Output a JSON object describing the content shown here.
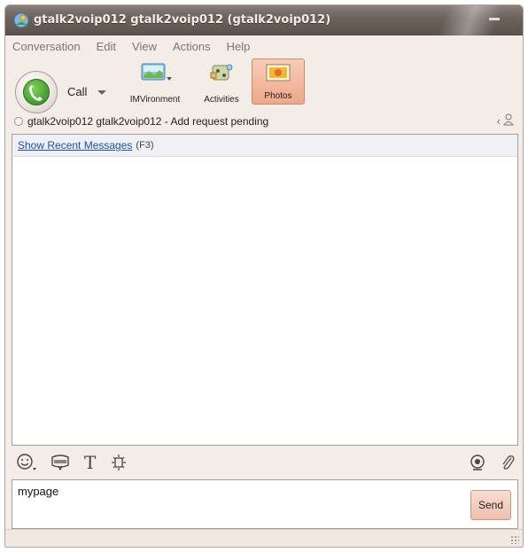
{
  "window": {
    "title": "gtalk2voip012 gtalk2voip012 (gtalk2voip012)"
  },
  "menu": {
    "items": [
      "Conversation",
      "Edit",
      "View",
      "Actions",
      "Help"
    ]
  },
  "toolbar": {
    "call_label": "Call",
    "imvironment_label": "IMVironment",
    "activities_label": "Activities",
    "photos_label": "Photos"
  },
  "status": {
    "contact_line": "gtalk2voip012 gtalk2voip012 - Add request pending"
  },
  "conversation": {
    "show_recent_label": "Show Recent Messages",
    "show_recent_shortcut": "(F3)"
  },
  "input": {
    "value": "mypage",
    "send_label": "Send"
  },
  "colors": {
    "titlebar": "#6b625c",
    "window_bg": "#f4ece6",
    "accent_button": "#efbfab",
    "link": "#1c4fb5"
  },
  "icons": {
    "app": "messenger-buddy-icon",
    "call": "phone-icon",
    "imvironment": "imvironment-icon",
    "activities": "activities-icon",
    "photos": "photos-icon",
    "emoticon": "smiley-icon",
    "wink": "wink-icon",
    "font": "font-icon",
    "nudge": "nudge-icon",
    "webcam": "webcam-icon",
    "attach": "paperclip-icon"
  }
}
